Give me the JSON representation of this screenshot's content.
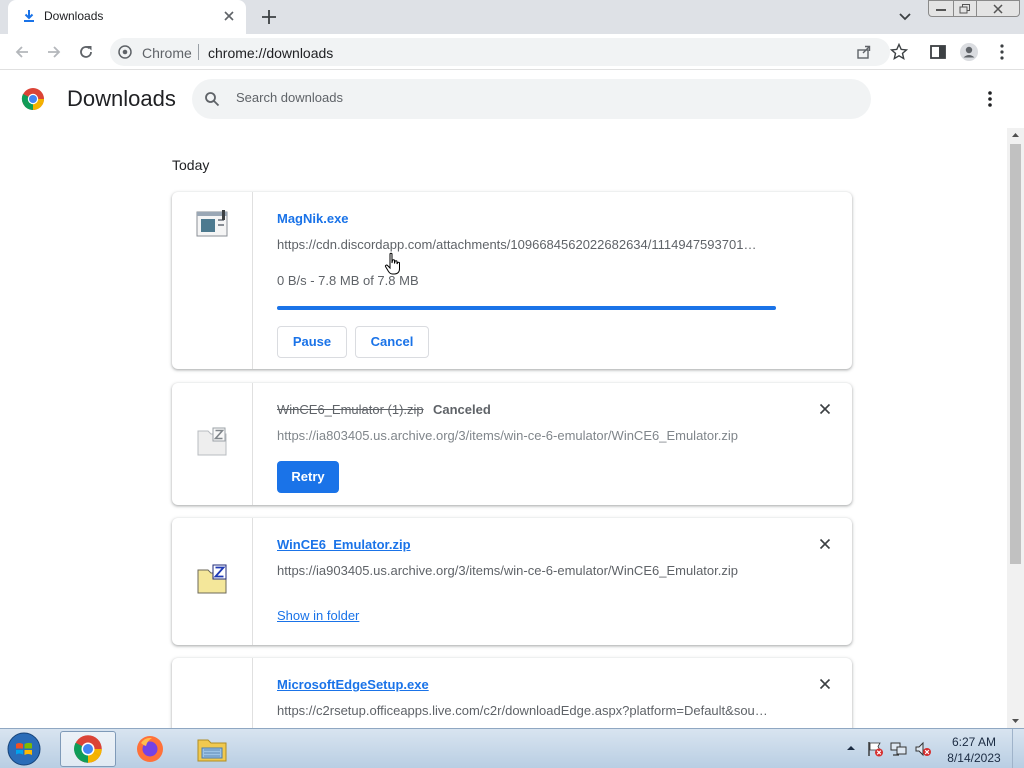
{
  "browser": {
    "tab": {
      "title": "Downloads"
    },
    "omnibox": {
      "chip": "Chrome",
      "url": "chrome://downloads"
    }
  },
  "page": {
    "title": "Downloads",
    "search_placeholder": "Search downloads",
    "section": "Today"
  },
  "downloads": [
    {
      "name": "MagNik.exe",
      "url": "https://cdn.discordapp.com/attachments/1096684562022682634/1114947593701…",
      "progress_text": "0 B/s - 7.8 MB of 7.8 MB",
      "progress_fraction": 0.999,
      "pause_label": "Pause",
      "cancel_label": "Cancel"
    },
    {
      "name": "WinCE6_Emulator (1).zip",
      "status": "Canceled",
      "url": "https://ia803405.us.archive.org/3/items/win-ce-6-emulator/WinCE6_Emulator.zip",
      "retry_label": "Retry"
    },
    {
      "name": "WinCE6_Emulator.zip",
      "url": "https://ia903405.us.archive.org/3/items/win-ce-6-emulator/WinCE6_Emulator.zip",
      "show_in_folder_label": "Show in folder"
    },
    {
      "name": "MicrosoftEdgeSetup.exe",
      "url": "https://c2rsetup.officeapps.live.com/c2r/downloadEdge.aspx?platform=Default&sou…"
    }
  ],
  "taskbar": {
    "clock_time": "6:27 AM",
    "clock_date": "8/14/2023"
  },
  "colors": {
    "accent": "#1a73e8",
    "tab_strip": "#dee1e6",
    "muted_text": "#5f6368"
  }
}
